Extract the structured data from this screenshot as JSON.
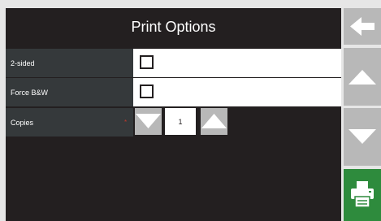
{
  "header": {
    "title": "Print Options"
  },
  "options": {
    "two_sided": {
      "label": "2-sided",
      "checked": false
    },
    "force_bw": {
      "label": "Force B&W",
      "checked": false
    },
    "copies": {
      "label": "Copies",
      "required_marker": "*",
      "value": "1"
    }
  },
  "sidebar": {
    "back_icon": "arrow-left-icon",
    "scroll_up_icon": "triangle-up-icon",
    "scroll_down_icon": "triangle-down-icon",
    "print_icon": "printer-icon"
  },
  "colors": {
    "panel_bg": "#231f20",
    "label_bg": "#35393b",
    "button_gray": "#b8b8b8",
    "print_green": "#2e8b3d",
    "required_red": "#c0392b"
  }
}
